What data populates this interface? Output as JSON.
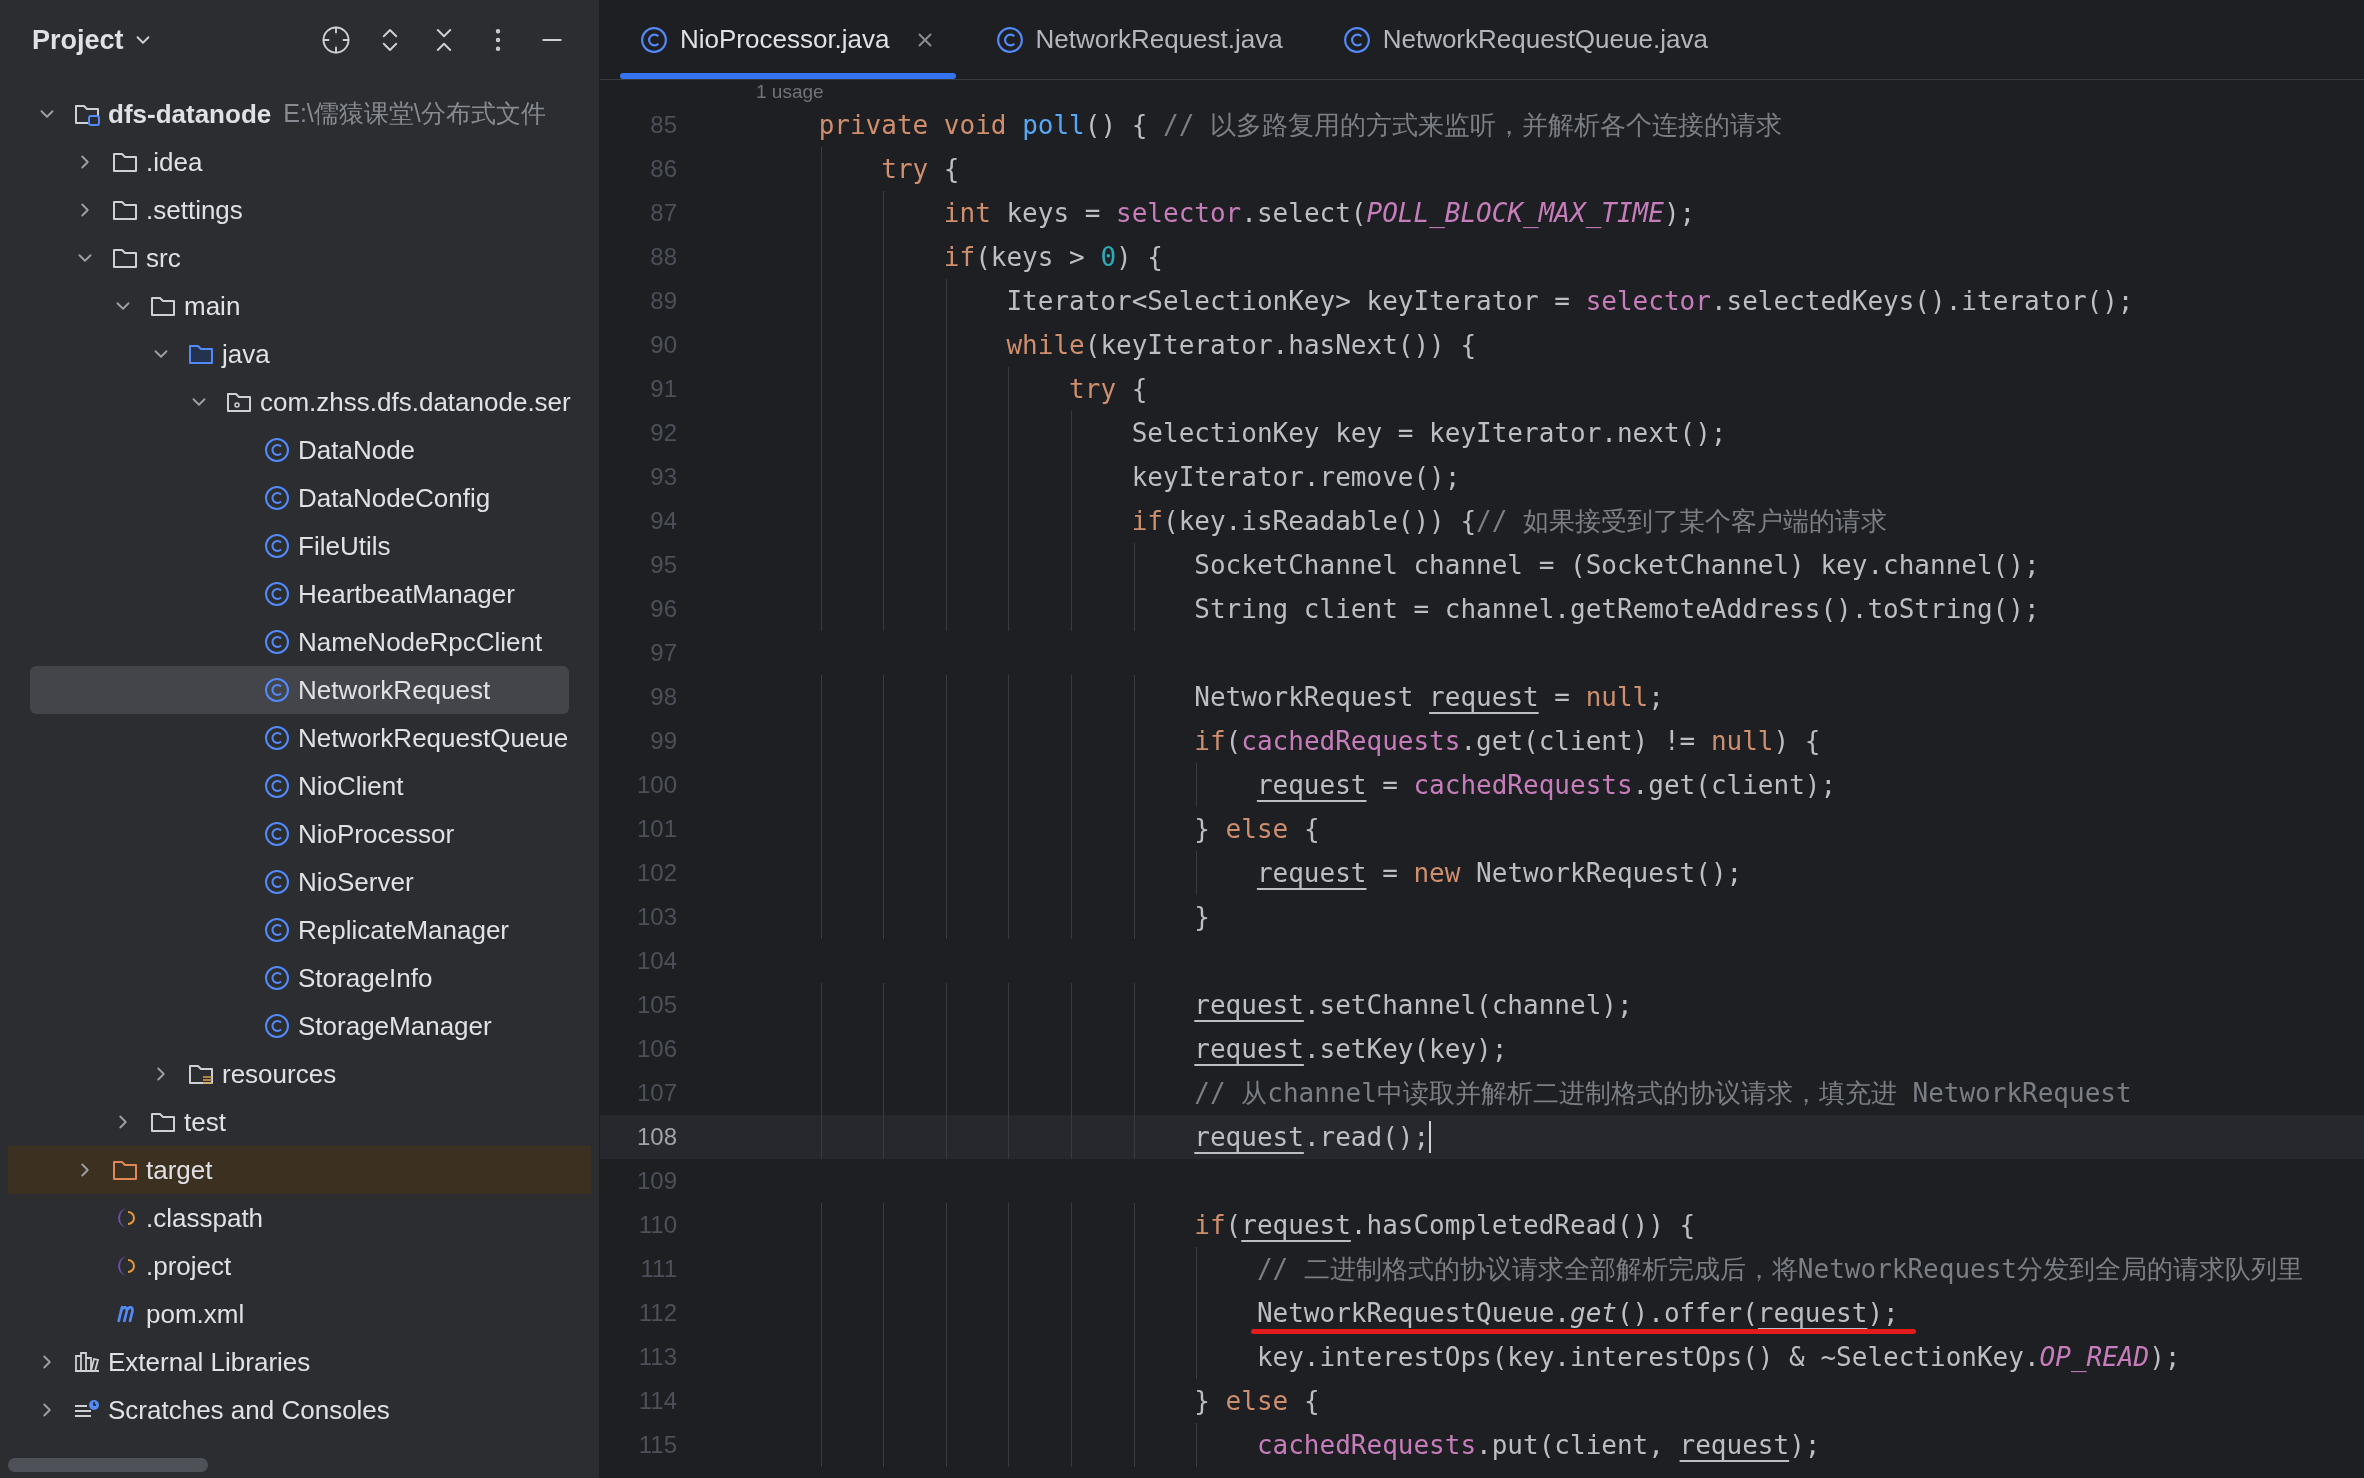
{
  "sidebar": {
    "title": "Project",
    "tree": [
      {
        "label": "dfs-datanode",
        "path": "E:\\儒猿课堂\\分布式文件",
        "kind": "module",
        "expanded": true,
        "selected": false,
        "children": [
          {
            "label": ".idea",
            "kind": "folder",
            "expanded": false,
            "selected": false
          },
          {
            "label": ".settings",
            "kind": "folder",
            "expanded": false,
            "selected": false
          },
          {
            "label": "src",
            "kind": "folder",
            "expanded": true,
            "selected": false,
            "children": [
              {
                "label": "main",
                "kind": "folder",
                "expanded": true,
                "selected": false,
                "children": [
                  {
                    "label": "java",
                    "kind": "source_folder",
                    "expanded": true,
                    "selected": false,
                    "children": [
                      {
                        "label": "com.zhss.dfs.datanode.ser",
                        "kind": "package",
                        "expanded": true,
                        "selected": false,
                        "children": [
                          {
                            "label": "DataNode",
                            "kind": "class",
                            "selected": false
                          },
                          {
                            "label": "DataNodeConfig",
                            "kind": "class",
                            "selected": false
                          },
                          {
                            "label": "FileUtils",
                            "kind": "class",
                            "selected": false
                          },
                          {
                            "label": "HeartbeatManager",
                            "kind": "class",
                            "selected": false
                          },
                          {
                            "label": "NameNodeRpcClient",
                            "kind": "class",
                            "selected": false
                          },
                          {
                            "label": "NetworkRequest",
                            "kind": "class",
                            "selected": true
                          },
                          {
                            "label": "NetworkRequestQueue",
                            "kind": "class",
                            "selected": false
                          },
                          {
                            "label": "NioClient",
                            "kind": "class",
                            "selected": false
                          },
                          {
                            "label": "NioProcessor",
                            "kind": "class",
                            "selected": false
                          },
                          {
                            "label": "NioServer",
                            "kind": "class",
                            "selected": false
                          },
                          {
                            "label": "ReplicateManager",
                            "kind": "class",
                            "selected": false
                          },
                          {
                            "label": "StorageInfo",
                            "kind": "class",
                            "selected": false
                          },
                          {
                            "label": "StorageManager",
                            "kind": "class",
                            "selected": false
                          }
                        ]
                      }
                    ]
                  },
                  {
                    "label": "resources",
                    "kind": "resources_folder",
                    "expanded": false,
                    "selected": false
                  }
                ]
              },
              {
                "label": "test",
                "kind": "folder",
                "expanded": false,
                "selected": false
              }
            ]
          },
          {
            "label": "target",
            "kind": "excluded_folder",
            "expanded": false,
            "selected": false
          },
          {
            "label": ".classpath",
            "kind": "eclipse_file",
            "selected": false
          },
          {
            "label": ".project",
            "kind": "eclipse_file",
            "selected": false
          },
          {
            "label": "pom.xml",
            "kind": "maven_file",
            "selected": false
          }
        ]
      },
      {
        "label": "External Libraries",
        "kind": "libraries",
        "expanded": false,
        "selected": false
      },
      {
        "label": "Scratches and Consoles",
        "kind": "scratches",
        "expanded": false,
        "selected": false
      }
    ]
  },
  "tabs": [
    {
      "label": "NioProcessor.java",
      "selected": true
    },
    {
      "label": "NetworkRequest.java",
      "selected": false
    },
    {
      "label": "NetworkRequestQueue.java",
      "selected": false
    }
  ],
  "editor": {
    "usage_hint": "1 usage",
    "lines": [
      {
        "number": "85",
        "current": false,
        "marked": false,
        "tokens": [
          {
            "kind": "kw",
            "text": "    private void "
          },
          {
            "kind": "fn",
            "text": "poll"
          },
          {
            "kind": "plain",
            "text": "() { "
          },
          {
            "kind": "comment",
            "text": "// 以多路复用的方式来监听，并解析各个连接的请求"
          }
        ]
      },
      {
        "number": "86",
        "current": false,
        "marked": false,
        "tokens": [
          {
            "kind": "kw",
            "text": "        try"
          },
          {
            "kind": "plain",
            "text": " {"
          }
        ]
      },
      {
        "number": "87",
        "current": false,
        "marked": false,
        "tokens": [
          {
            "kind": "kw",
            "text": "            int"
          },
          {
            "kind": "plain",
            "text": " keys = "
          },
          {
            "kind": "field",
            "text": "selector"
          },
          {
            "kind": "plain",
            "text": ".select("
          },
          {
            "kind": "const",
            "text": "POLL_BLOCK_MAX_TIME"
          },
          {
            "kind": "plain",
            "text": ");"
          }
        ]
      },
      {
        "number": "88",
        "current": false,
        "marked": false,
        "tokens": [
          {
            "kind": "kw",
            "text": "            if"
          },
          {
            "kind": "plain",
            "text": "(keys > "
          },
          {
            "kind": "num",
            "text": "0"
          },
          {
            "kind": "plain",
            "text": ") {"
          }
        ]
      },
      {
        "number": "89",
        "current": false,
        "marked": false,
        "tokens": [
          {
            "kind": "plain",
            "text": "                Iterator<SelectionKey> keyIterator = "
          },
          {
            "kind": "field",
            "text": "selector"
          },
          {
            "kind": "plain",
            "text": ".selectedKeys().iterator();"
          }
        ]
      },
      {
        "number": "90",
        "current": false,
        "marked": false,
        "tokens": [
          {
            "kind": "kw",
            "text": "                while"
          },
          {
            "kind": "plain",
            "text": "(keyIterator.hasNext()) {"
          }
        ]
      },
      {
        "number": "91",
        "current": false,
        "marked": false,
        "tokens": [
          {
            "kind": "kw",
            "text": "                    try"
          },
          {
            "kind": "plain",
            "text": " {"
          }
        ]
      },
      {
        "number": "92",
        "current": false,
        "marked": false,
        "tokens": [
          {
            "kind": "plain",
            "text": "                        SelectionKey key = keyIterator.next();"
          }
        ]
      },
      {
        "number": "93",
        "current": false,
        "marked": false,
        "tokens": [
          {
            "kind": "plain",
            "text": "                        keyIterator.remove();"
          }
        ]
      },
      {
        "number": "94",
        "current": false,
        "marked": false,
        "tokens": [
          {
            "kind": "kw",
            "text": "                        if"
          },
          {
            "kind": "plain",
            "text": "(key.isReadable()) {"
          },
          {
            "kind": "comment",
            "text": "// 如果接受到了某个客户端的请求"
          }
        ]
      },
      {
        "number": "95",
        "current": false,
        "marked": false,
        "tokens": [
          {
            "kind": "plain",
            "text": "                            SocketChannel channel = (SocketChannel) key.channel();"
          }
        ]
      },
      {
        "number": "96",
        "current": false,
        "marked": false,
        "tokens": [
          {
            "kind": "plain",
            "text": "                            String client = channel.getRemoteAddress().toString();"
          }
        ]
      },
      {
        "number": "97",
        "current": false,
        "marked": false
      },
      {
        "number": "98",
        "current": false,
        "marked": false,
        "tokens": [
          {
            "kind": "plain",
            "text": "                            NetworkRequest "
          },
          {
            "kind": "var",
            "text": "request"
          },
          {
            "kind": "plain",
            "text": " = "
          },
          {
            "kind": "kw",
            "text": "null"
          },
          {
            "kind": "plain",
            "text": ";"
          }
        ]
      },
      {
        "number": "99",
        "current": false,
        "marked": false,
        "tokens": [
          {
            "kind": "kw",
            "text": "                            if"
          },
          {
            "kind": "plain",
            "text": "("
          },
          {
            "kind": "field",
            "text": "cachedRequests"
          },
          {
            "kind": "plain",
            "text": ".get(client) != "
          },
          {
            "kind": "kw",
            "text": "null"
          },
          {
            "kind": "plain",
            "text": ") {"
          }
        ]
      },
      {
        "number": "100",
        "current": false,
        "marked": false,
        "tokens": [
          {
            "kind": "var",
            "text": "                                request"
          },
          {
            "kind": "plain",
            "text": " = "
          },
          {
            "kind": "field",
            "text": "cachedRequests"
          },
          {
            "kind": "plain",
            "text": ".get(client);"
          }
        ]
      },
      {
        "number": "101",
        "current": false,
        "marked": false,
        "tokens": [
          {
            "kind": "plain",
            "text": "                            } "
          },
          {
            "kind": "kw",
            "text": "else"
          },
          {
            "kind": "plain",
            "text": " {"
          }
        ]
      },
      {
        "number": "102",
        "current": false,
        "marked": false,
        "tokens": [
          {
            "kind": "var",
            "text": "                                request"
          },
          {
            "kind": "plain",
            "text": " = "
          },
          {
            "kind": "kw",
            "text": "new"
          },
          {
            "kind": "plain",
            "text": " NetworkRequest();"
          }
        ]
      },
      {
        "number": "103",
        "current": false,
        "marked": false,
        "tokens": [
          {
            "kind": "plain",
            "text": "                            }"
          }
        ]
      },
      {
        "number": "104",
        "current": false,
        "marked": false
      },
      {
        "number": "105",
        "current": false,
        "marked": false,
        "tokens": [
          {
            "kind": "var",
            "text": "                            request"
          },
          {
            "kind": "plain",
            "text": ".setChannel(channel);"
          }
        ]
      },
      {
        "number": "106",
        "current": false,
        "marked": false,
        "tokens": [
          {
            "kind": "var",
            "text": "                            request"
          },
          {
            "kind": "plain",
            "text": ".setKey(key);"
          }
        ]
      },
      {
        "number": "107",
        "current": false,
        "marked": false,
        "tokens": [
          {
            "kind": "comment",
            "text": "                            // 从channel中读取并解析二进制格式的协议请求，填充进 NetworkRequest"
          }
        ]
      },
      {
        "number": "108",
        "current": true,
        "marked": false,
        "tokens": [
          {
            "kind": "var",
            "text": "                            request"
          },
          {
            "kind": "plain",
            "text": ".read();"
          }
        ]
      },
      {
        "number": "109",
        "current": false,
        "marked": false
      },
      {
        "number": "110",
        "current": false,
        "marked": false,
        "tokens": [
          {
            "kind": "kw",
            "text": "                            if"
          },
          {
            "kind": "plain",
            "text": "("
          },
          {
            "kind": "var",
            "text": "request"
          },
          {
            "kind": "plain",
            "text": ".hasCompletedRead()) {"
          }
        ]
      },
      {
        "number": "111",
        "current": false,
        "marked": false,
        "tokens": [
          {
            "kind": "comment",
            "text": "                                // 二进制格式的协议请求全部解析完成后，将NetworkRequest分发到全局的请求队列里"
          }
        ]
      },
      {
        "number": "112",
        "current": false,
        "marked": true,
        "tokens": [
          {
            "kind": "plain",
            "text": "                                NetworkRequestQueue."
          },
          {
            "kind": "static",
            "text": "get"
          },
          {
            "kind": "plain",
            "text": "().offer("
          },
          {
            "kind": "var",
            "text": "request"
          },
          {
            "kind": "plain",
            "text": ");"
          }
        ]
      },
      {
        "number": "113",
        "current": false,
        "marked": false,
        "tokens": [
          {
            "kind": "plain",
            "text": "                                key.interestOps(key.interestOps() & ~SelectionKey."
          },
          {
            "kind": "const",
            "text": "OP_READ"
          },
          {
            "kind": "plain",
            "text": ");"
          }
        ]
      },
      {
        "number": "114",
        "current": false,
        "marked": false,
        "tokens": [
          {
            "kind": "plain",
            "text": "                            } "
          },
          {
            "kind": "kw",
            "text": "else"
          },
          {
            "kind": "plain",
            "text": " {"
          }
        ]
      },
      {
        "number": "115",
        "current": false,
        "marked": false,
        "tokens": [
          {
            "kind": "field",
            "text": "                                cachedRequests"
          },
          {
            "kind": "plain",
            "text": ".put(client, "
          },
          {
            "kind": "var",
            "text": "request"
          },
          {
            "kind": "plain",
            "text": ");"
          }
        ]
      }
    ]
  }
}
